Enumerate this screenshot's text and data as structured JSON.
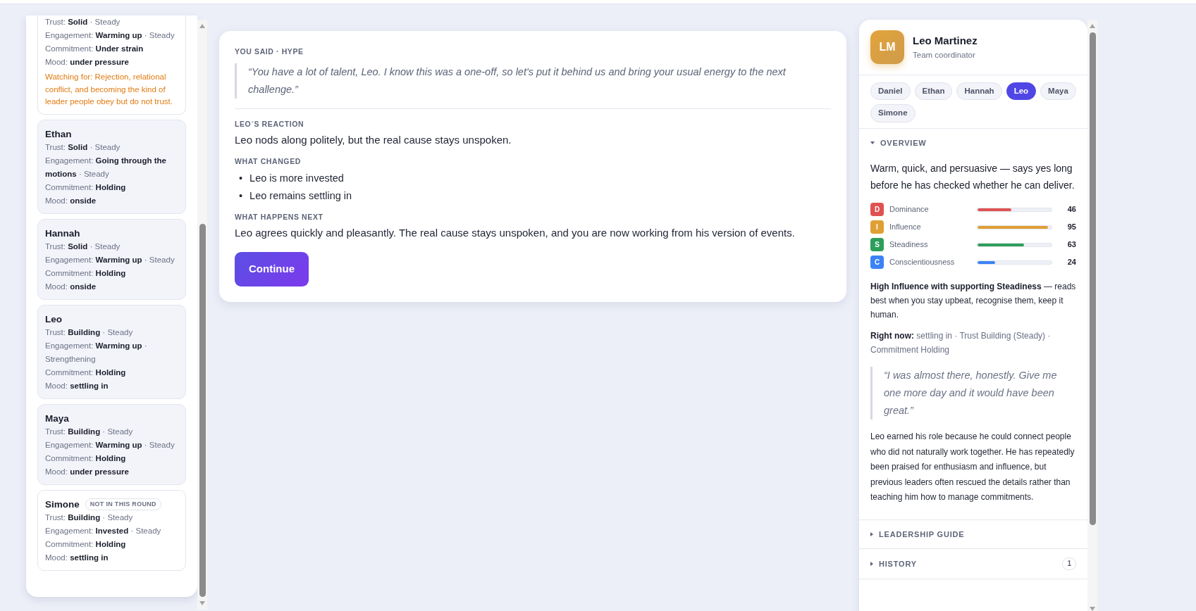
{
  "team_cards": [
    {
      "highlighted": true,
      "stats": [
        {
          "label": "Trust:",
          "value": "Solid",
          "trend": "· Steady"
        },
        {
          "label": "Engagement:",
          "value": "Warming up",
          "trend": "· Steady"
        },
        {
          "label": "Commitment:",
          "value": "Under strain"
        },
        {
          "label": "Mood:",
          "value": "under pressure"
        }
      ],
      "watching": "Watching for: Rejection, relational conflict, and becoming the kind of leader people obey but do not trust."
    },
    {
      "name": "Ethan",
      "highlighted": false,
      "stats": [
        {
          "label": "Trust:",
          "value": "Solid",
          "trend": "· Steady"
        },
        {
          "label": "Engagement:",
          "value": "Going through the motions",
          "trend": "· Steady"
        },
        {
          "label": "Commitment:",
          "value": "Holding"
        },
        {
          "label": "Mood:",
          "value": "onside"
        }
      ]
    },
    {
      "name": "Hannah",
      "highlighted": false,
      "stats": [
        {
          "label": "Trust:",
          "value": "Solid",
          "trend": "· Steady"
        },
        {
          "label": "Engagement:",
          "value": "Warming up",
          "trend": "· Steady"
        },
        {
          "label": "Commitment:",
          "value": "Holding"
        },
        {
          "label": "Mood:",
          "value": "onside"
        }
      ]
    },
    {
      "name": "Leo",
      "highlighted": false,
      "stats": [
        {
          "label": "Trust:",
          "value": "Building",
          "trend": "· Steady"
        },
        {
          "label": "Engagement:",
          "value": "Warming up",
          "trend": "· Strengthening"
        },
        {
          "label": "Commitment:",
          "value": "Holding"
        },
        {
          "label": "Mood:",
          "value": "settling in"
        }
      ]
    },
    {
      "name": "Maya",
      "highlighted": false,
      "stats": [
        {
          "label": "Trust:",
          "value": "Building",
          "trend": "· Steady"
        },
        {
          "label": "Engagement:",
          "value": "Warming up",
          "trend": "· Steady"
        },
        {
          "label": "Commitment:",
          "value": "Holding"
        },
        {
          "label": "Mood:",
          "value": "under pressure"
        }
      ]
    },
    {
      "name": "Simone",
      "highlighted": true,
      "tag": "NOT IN THIS ROUND",
      "stats": [
        {
          "label": "Trust:",
          "value": "Building",
          "trend": "· Steady"
        },
        {
          "label": "Engagement:",
          "value": "Invested",
          "trend": "· Steady"
        },
        {
          "label": "Commitment:",
          "value": "Holding"
        },
        {
          "label": "Mood:",
          "value": "settling in"
        }
      ]
    }
  ],
  "result": {
    "you_said_label": "YOU SAID · HYPE",
    "you_said": "“You have a lot of talent, Leo. I know this was a one-off, so let's put it behind us and bring your usual energy to the next challenge.”",
    "sections": [
      {
        "kind": "text",
        "heading": "LEO´S REACTION",
        "text": "Leo nods along politely, but the real cause stays unspoken."
      },
      {
        "kind": "list",
        "heading": "WHAT CHANGED",
        "items": [
          {
            "bullet": "•",
            "text": "Leo is more invested"
          },
          {
            "bullet": "•",
            "text": "Leo remains settling in"
          }
        ]
      },
      {
        "kind": "text",
        "heading": "WHAT HAPPENS NEXT",
        "text": "Leo agrees quickly and pleasantly. The real cause stays unspoken, and you are now working from his version of events."
      }
    ],
    "button": "Continue"
  },
  "profile": {
    "initials": "LM",
    "name": "Leo Martinez",
    "role": "Team coordinator",
    "chips": [
      {
        "label": "Daniel",
        "selected": false
      },
      {
        "label": "Ethan",
        "selected": false
      },
      {
        "label": "Hannah",
        "selected": false
      },
      {
        "label": "Leo",
        "selected": true
      },
      {
        "label": "Maya",
        "selected": false
      },
      {
        "label": "Simone",
        "selected": false
      }
    ],
    "sections": [
      {
        "title": "OVERVIEW",
        "expanded": true,
        "summary": "Warm, quick, and persuasive — says yes long before he has checked whether he can deliver.",
        "disc": [
          {
            "letter": "D",
            "label": "Dominance",
            "value": "46",
            "level": 0.46,
            "color": "#e05252"
          },
          {
            "letter": "I",
            "label": "Influence",
            "value": "95",
            "level": 0.95,
            "color": "#e09f33"
          },
          {
            "letter": "S",
            "label": "Steadiness",
            "value": "63",
            "level": 0.63,
            "color": "#2e9e5b"
          },
          {
            "letter": "C",
            "label": "Conscientiousness",
            "value": "24",
            "level": 0.24,
            "color": "#3b82f6"
          }
        ],
        "style_note": "**High Influence with supporting Steadiness** — reads best when you stay upbeat, recognise them, keep it human.",
        "right_now": "**Right now:** settling in · Trust Building (Steady) · Commitment Holding",
        "quote": "“I was almost there, honestly. Give me one more day and it would have been great.”",
        "bio": "Leo earned his role because he could connect people who did not naturally work together. He has repeatedly been praised for enthusiasm and influence, but previous leaders often rescued the details rather than teaching him how to manage commitments."
      },
      {
        "title": "LEADERSHIP GUIDE",
        "expanded": false
      },
      {
        "title": "HISTORY",
        "expanded": false,
        "badge": "1"
      }
    ]
  }
}
